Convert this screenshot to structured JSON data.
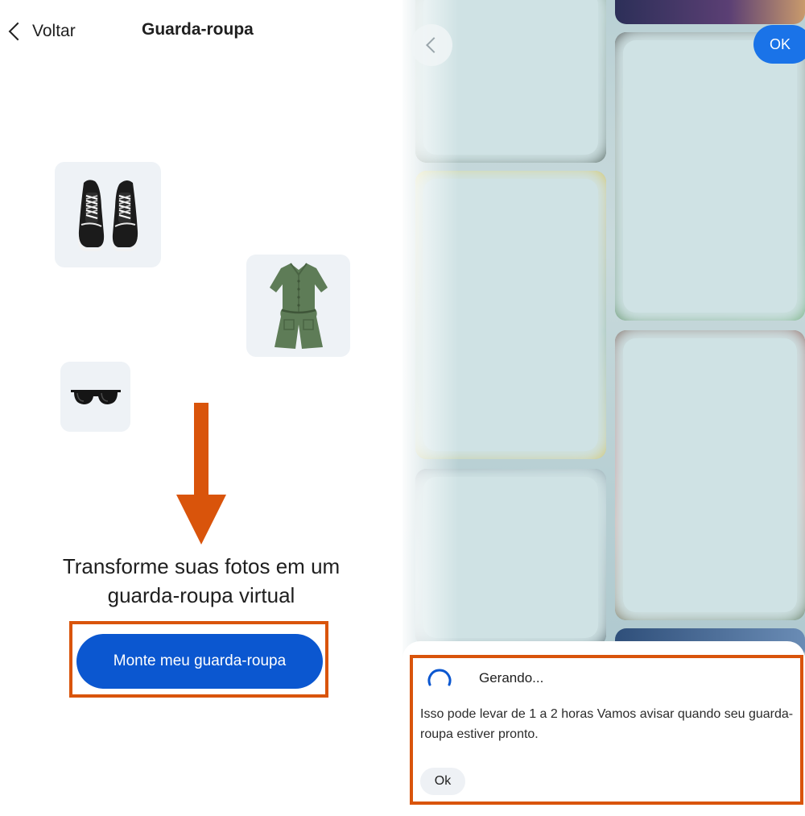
{
  "left_screen": {
    "header": {
      "back_label": "Voltar",
      "title": "Guarda-roupa"
    },
    "items": [
      {
        "icon": "sneakers-icon"
      },
      {
        "icon": "romper-icon"
      },
      {
        "icon": "sunglasses-icon"
      }
    ],
    "headline_line1": "Transforme suas fotos em um",
    "headline_line2": "guarda-roupa virtual",
    "cta_label": "Monte meu guarda-roupa"
  },
  "right_screen": {
    "ok_top_label": "OK",
    "dialog": {
      "title": "Gerando...",
      "message": "Isso pode levar de 1 a 2 horas Vamos avisar quando seu guarda-roupa estiver pronto.",
      "ok_label": "Ok"
    }
  },
  "colors": {
    "accent_blue": "#0b57d0",
    "highlight_orange": "#d9540b",
    "tile_bg": "#eef2f6"
  }
}
